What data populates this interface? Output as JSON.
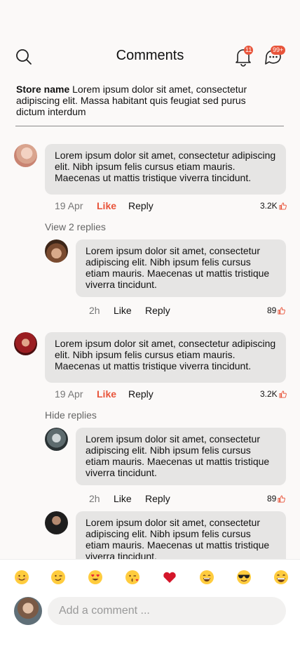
{
  "header": {
    "title": "Comments",
    "notif_badge": "11",
    "chat_badge": "99+"
  },
  "store": {
    "name": "Store name",
    "text": "Lorem ipsum dolor sit amet, consectetur adipiscing elit. Massa habitant quis feugiat sed purus dictum interdum"
  },
  "comments": [
    {
      "text": "Lorem ipsum dolor sit amet, consectetur adipiscing elit. Nibh ipsum felis cursus etiam mauris. Maecenas ut mattis tristique viverra tincidunt.",
      "date": "19 Apr",
      "like": "Like",
      "reply": "Reply",
      "count": "3.2K",
      "replies_toggle": "View 2 replies",
      "replies": [
        {
          "text": "Lorem ipsum dolor sit amet, consectetur adipiscing elit. Nibh ipsum felis cursus etiam mauris. Maecenas ut mattis tristique viverra tincidunt.",
          "date": "2h",
          "like": "Like",
          "reply": "Reply",
          "count": "89"
        }
      ]
    },
    {
      "text": "Lorem ipsum dolor sit amet, consectetur adipiscing elit. Nibh ipsum felis cursus etiam mauris. Maecenas ut mattis tristique viverra tincidunt.",
      "date": "19 Apr",
      "like": "Like",
      "reply": "Reply",
      "count": "3.2K",
      "replies_toggle": "Hide replies",
      "replies": [
        {
          "text": "Lorem ipsum dolor sit amet, consectetur adipiscing elit. Nibh ipsum felis cursus etiam mauris. Maecenas ut mattis tristique viverra tincidunt.",
          "date": "2h",
          "like": "Like",
          "reply": "Reply",
          "count": "89"
        },
        {
          "text": "Lorem ipsum dolor sit amet, consectetur adipiscing elit. Nibh ipsum felis cursus etiam mauris. Maecenas ut mattis tristique viverra tincidunt."
        }
      ]
    }
  ],
  "emojis": [
    "smiling-face-icon",
    "winking-face-icon",
    "heart-eyes-face-icon",
    "kissing-face-icon",
    "red-heart-icon",
    "grinning-face-icon",
    "sunglasses-face-icon",
    "beaming-face-icon"
  ],
  "composer": {
    "placeholder": "Add a comment ..."
  },
  "colors": {
    "accent": "#e8543a",
    "bubble": "#e6e5e4",
    "background": "#fbf9f8"
  }
}
